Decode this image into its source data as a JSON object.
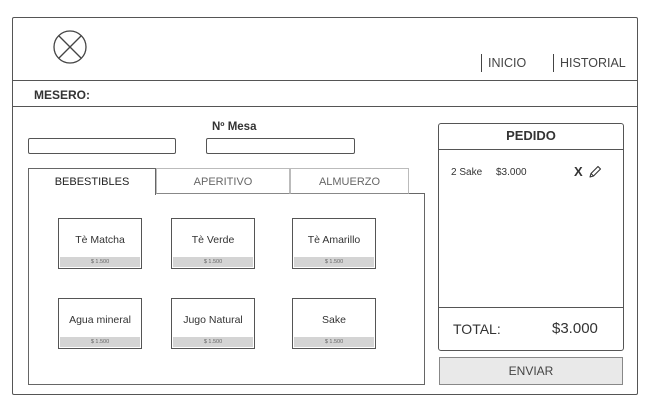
{
  "header": {
    "nav": [
      {
        "label": "INICIO"
      },
      {
        "label": "HISTORIAL"
      }
    ]
  },
  "waiter": {
    "label": "MESERO:"
  },
  "table": {
    "label": "Nº Mesa"
  },
  "tabs": [
    {
      "label": "BEBESTIBLES",
      "active": true
    },
    {
      "label": "APERITIVO",
      "active": false
    },
    {
      "label": "ALMUERZO",
      "active": false
    }
  ],
  "products": [
    {
      "name": "Tè Matcha",
      "price": "$ 1.500"
    },
    {
      "name": "Tè Verde",
      "price": "$ 1.500"
    },
    {
      "name": "Tè Amarillo",
      "price": "$ 1.500"
    },
    {
      "name": "Agua mineral",
      "price": "$ 1.500"
    },
    {
      "name": "Jugo Natural",
      "price": "$ 1.500"
    },
    {
      "name": "Sake",
      "price": "$ 1.500"
    }
  ],
  "order": {
    "title": "PEDIDO",
    "items": [
      {
        "qty_name": "2 Sake",
        "amount": "$3.000",
        "remove_icon": "close-icon",
        "edit_icon": "pencil-icon"
      }
    ],
    "total_label": "TOTAL:",
    "total_value": "$3.000",
    "send_label": "ENVIAR"
  }
}
